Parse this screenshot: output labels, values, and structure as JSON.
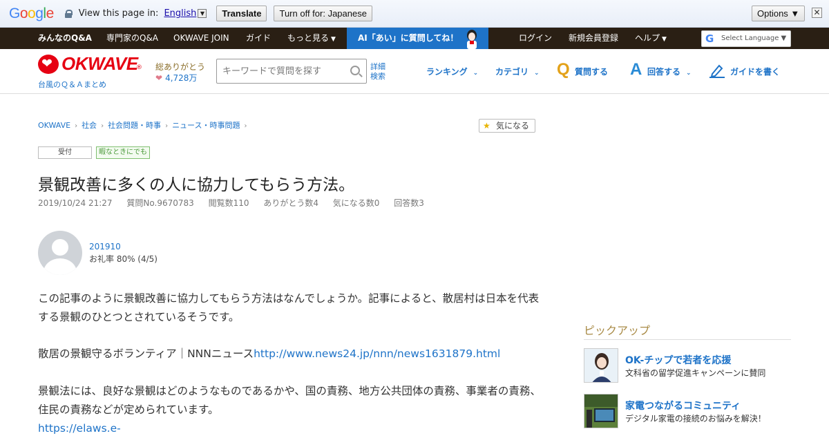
{
  "translate_bar": {
    "logo": "Google",
    "prompt": "View this page in:",
    "language": "English",
    "translate_label": "Translate",
    "turn_off_label": "Turn off for: Japanese",
    "options_label": "Options ▼",
    "close_label": "✕"
  },
  "topnav": {
    "items": [
      "みんなのQ&A",
      "専門家のQ&A",
      "OKWAVE JOIN",
      "ガイド",
      "もっと見る"
    ],
    "ai_label": "AI「あい」に質問してね！",
    "right_items": [
      "ログイン",
      "新規会員登録",
      "ヘルプ"
    ],
    "select_language": "Select Language ▼"
  },
  "header": {
    "logo_text": "OKWAVE",
    "logo_reg": "®",
    "logo_sub": "台風のＱ＆Ａまとめ",
    "thanks_label": "総ありがとう",
    "thanks_count": "4,728万",
    "search_placeholder": "キーワードで質問を探す",
    "advanced_search": "詳細検索",
    "nav": {
      "ranking": "ランキング",
      "category": "カテゴリ",
      "ask_letter": "Q",
      "ask": "質問する",
      "answer_letter": "A",
      "answer": "回答する",
      "guide": "ガイドを書く"
    }
  },
  "breadcrumb": [
    "OKWAVE",
    "社会",
    "社会問題・時事",
    "ニュース・時事問題"
  ],
  "watch_button": "気になる",
  "tags": {
    "status": "受付",
    "category": "暇なときにでも"
  },
  "question": {
    "title": "景観改善に多くの人に協力してもらう方法。",
    "date": "2019/10/24 21:27",
    "number": "質問No.9670783",
    "views": "閲覧数110",
    "thanks": "ありがとう数4",
    "watch_count": "気になる数0",
    "answers": "回答数3"
  },
  "user": {
    "name": "201910",
    "rate": "お礼率 80%   (4/5)"
  },
  "body": {
    "para1": "この記事のように景観改善に協力してもらう方法はなんでしょうか。記事によると、散居村は日本を代表する景観のひとつとされているそうです。",
    "para2_text": "散居の景観守るボランティア｜NNNニュース",
    "para2_link": "http://www.news24.jp/nnn/news1631879.html",
    "para3": "景観法には、良好な景観はどのようなものであるかや、国の責務、地方公共団体の責務、事業者の責務、住民の責務などが定められています。",
    "para3_link": "https://elaws.e-"
  },
  "pickup": {
    "heading": "ピックアップ",
    "items": [
      {
        "title": "OK-チップで若者を応援",
        "subtitle": "文科省の留学促進キャンペーンに賛同"
      },
      {
        "title": "家電つながるコミュニティ",
        "subtitle": "デジタル家電の接続のお悩みを解決！"
      }
    ]
  },
  "colors": {
    "brand_red": "#e60012",
    "link_blue": "#1e73c8",
    "nav_dark": "#2a1f14",
    "ai_blue": "#1e73c8"
  }
}
